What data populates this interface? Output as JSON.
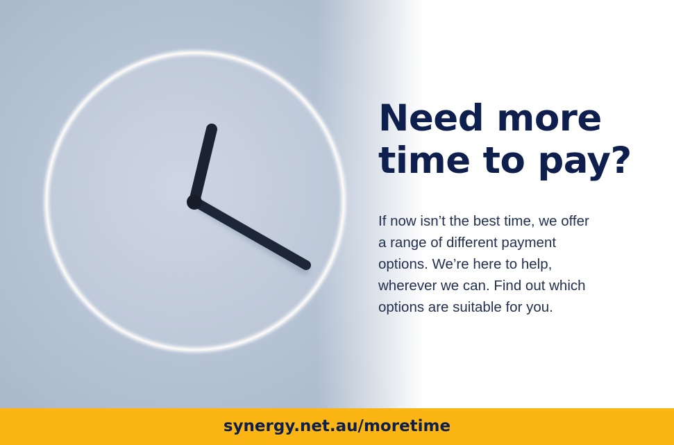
{
  "headline": {
    "lines": [
      "Need more",
      "time to pay?"
    ]
  },
  "body": {
    "lines": [
      "If now isn’t the best time, we offer",
      "a range of different payment",
      "options. We’re here to help,",
      "wherever we can. Find out which",
      "options are suitable for you."
    ]
  },
  "footer": {
    "url_label": "synergy.net.au/moretime"
  },
  "colors": {
    "navy": "#0e1f4d",
    "accent_yellow": "#fbb515",
    "photo_blue": "#b7c4d5"
  },
  "image": {
    "subject": "clock-icon"
  }
}
